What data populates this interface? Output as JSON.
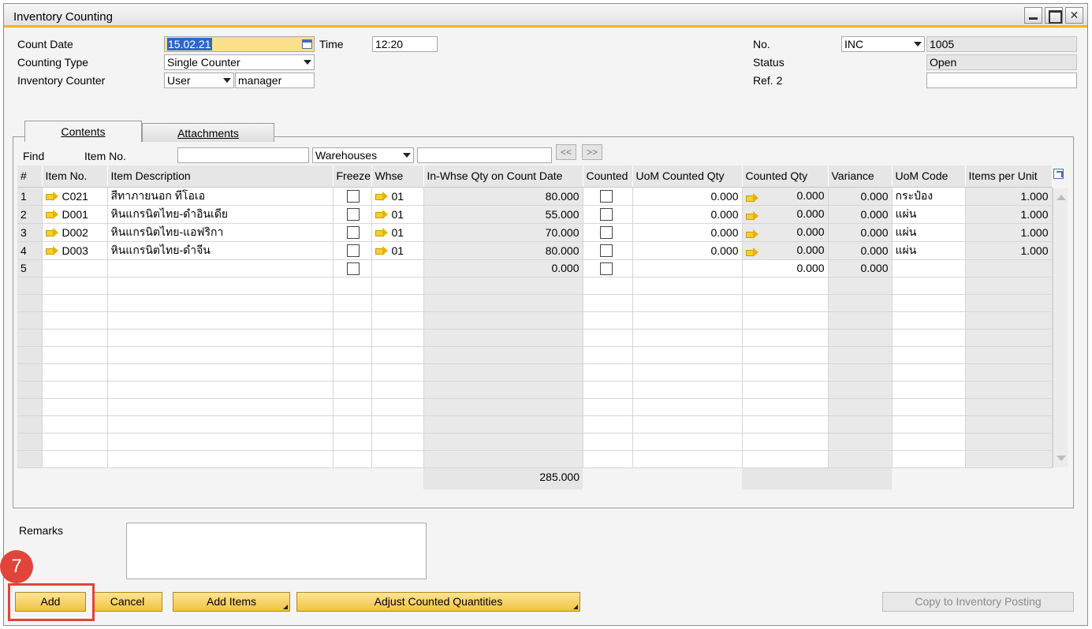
{
  "window": {
    "title": "Inventory Counting"
  },
  "header": {
    "count_date_label": "Count Date",
    "count_date": "15.02.21",
    "time_label": "Time",
    "time": "12:20",
    "counting_type_label": "Counting Type",
    "counting_type": "Single Counter",
    "inventory_counter_label": "Inventory Counter",
    "counter_type": "User",
    "counter_name": "manager",
    "no_label": "No.",
    "series": "INC",
    "doc_number": "1005",
    "status_label": "Status",
    "status": "Open",
    "ref2_label": "Ref. 2",
    "ref2": ""
  },
  "tabs": [
    {
      "label": "Contents"
    },
    {
      "label": "Attachments"
    }
  ],
  "find": {
    "find_label": "Find",
    "item_no_label": "Item No.",
    "item_no_value": "",
    "warehouses": "Warehouses",
    "warehouse_value": "",
    "prev_label": "<<",
    "next_label": ">>"
  },
  "columns": [
    "#",
    "Item No.",
    "Item Description",
    "Freeze",
    "Whse",
    "In-Whse Qty on Count Date",
    "Counted",
    "UoM Counted Qty",
    "Counted Qty",
    "Variance",
    "UoM Code",
    "Items per Unit"
  ],
  "rows": [
    {
      "n": "1",
      "item": "C021",
      "desc": "สีทาภายนอก ทีโอเอ",
      "whse": "01",
      "inwhse": "80.000",
      "uom_counted": "0.000",
      "counted_qty": "0.000",
      "variance": "0.000",
      "uom_code": "กระป๋อง",
      "per_unit": "1.000"
    },
    {
      "n": "2",
      "item": "D001",
      "desc": "หินแกรนิตไทย-ดำอินเดีย",
      "whse": "01",
      "inwhse": "55.000",
      "uom_counted": "0.000",
      "counted_qty": "0.000",
      "variance": "0.000",
      "uom_code": "แผ่น",
      "per_unit": "1.000"
    },
    {
      "n": "3",
      "item": "D002",
      "desc": "หินแกรนิตไทย-แอฟริกา",
      "whse": "01",
      "inwhse": "70.000",
      "uom_counted": "0.000",
      "counted_qty": "0.000",
      "variance": "0.000",
      "uom_code": "แผ่น",
      "per_unit": "1.000"
    },
    {
      "n": "4",
      "item": "D003",
      "desc": "หินแกรนิตไทย-ดำจีน",
      "whse": "01",
      "inwhse": "80.000",
      "uom_counted": "0.000",
      "counted_qty": "0.000",
      "variance": "0.000",
      "uom_code": "แผ่น",
      "per_unit": "1.000"
    },
    {
      "n": "5",
      "item": "",
      "desc": "",
      "whse": "",
      "inwhse": "0.000",
      "uom_counted": "",
      "counted_qty": "0.000",
      "variance": "0.000",
      "uom_code": "",
      "per_unit": ""
    }
  ],
  "totals": {
    "inwhse_total": "285.000"
  },
  "remarks": {
    "label": "Remarks",
    "value": ""
  },
  "buttons": {
    "add": "Add",
    "cancel": "Cancel",
    "add_items": "Add Items",
    "adjust": "Adjust Counted Quantities",
    "copy": "Copy to Inventory Posting"
  },
  "annotation": {
    "step": "7"
  },
  "colors": {
    "accent": "#f2b51b",
    "button": "#f0c440",
    "highlight": "#e0443a",
    "selection": "#2a68c9"
  }
}
